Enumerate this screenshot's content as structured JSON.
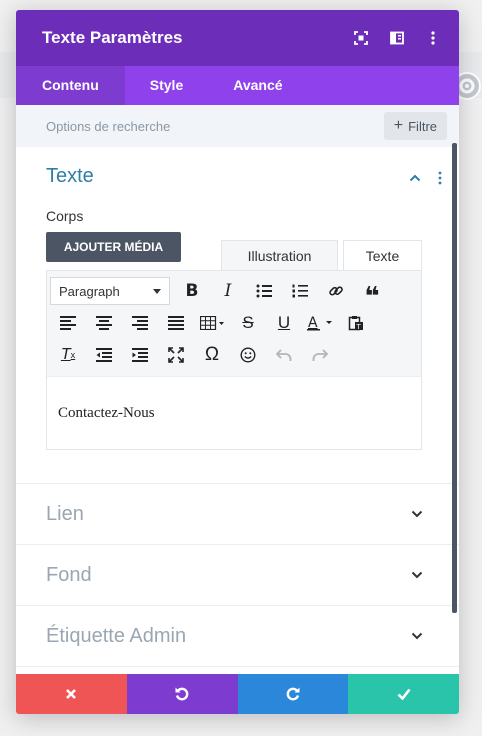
{
  "modal": {
    "title": "Texte Paramètres",
    "header_icons": [
      "expand-icon",
      "sidebar-toggle-icon",
      "more-vertical-icon"
    ]
  },
  "tabs": [
    {
      "label": "Contenu",
      "active": true
    },
    {
      "label": "Style",
      "active": false
    },
    {
      "label": "Avancé",
      "active": false
    }
  ],
  "search": {
    "placeholder": "Options de recherche",
    "filter_label": "Filtre"
  },
  "section_text": {
    "title": "Texte",
    "field_label": "Corps",
    "add_media_label": "AJOUTER MÉDIA",
    "editor_tabs": [
      "Illustration",
      "Texte"
    ],
    "format_select": "Paragraph",
    "content": "Contactez-Nous"
  },
  "sections_closed": [
    "Lien",
    "Fond",
    "Étiquette Admin"
  ],
  "colors": {
    "header": "#6c2eb9",
    "tabs": "#8f42ec",
    "cancel": "#ef5555",
    "undo": "#7e3bd0",
    "redo": "#2b87da",
    "save": "#29c4a9",
    "section_title": "#2e7ea6"
  }
}
